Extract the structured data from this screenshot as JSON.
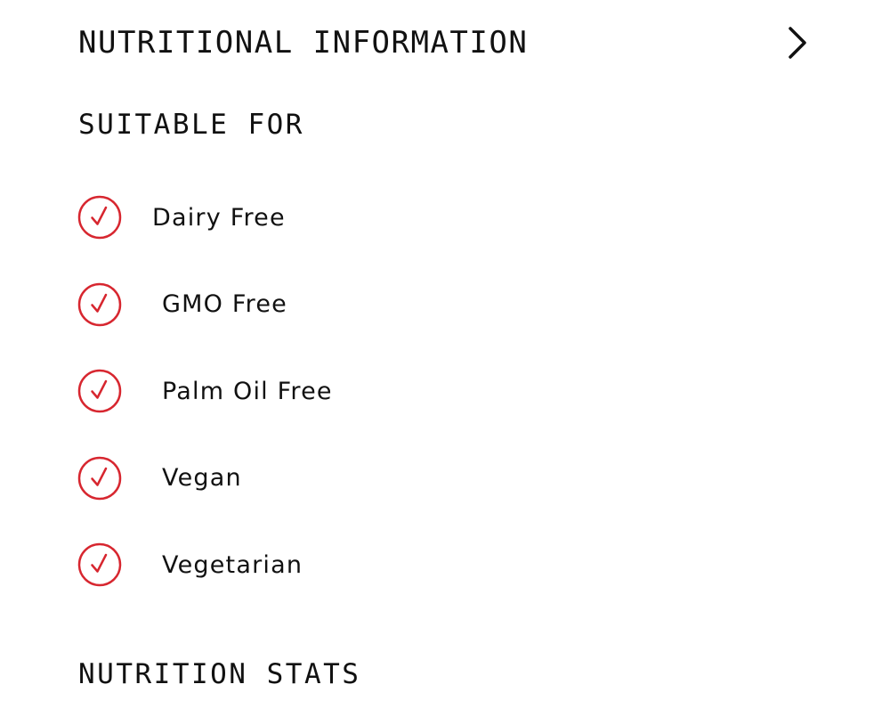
{
  "accordion": {
    "title": "NUTRITIONAL INFORMATION",
    "toggle_icon": "chevron-right-icon"
  },
  "suitable_for": {
    "heading": "SUITABLE FOR",
    "check_icon": "check-circle-icon",
    "accent_color": "#d7262f",
    "items": [
      {
        "label": "Dairy Free"
      },
      {
        "label": "GMO Free"
      },
      {
        "label": "Palm Oil Free"
      },
      {
        "label": "Vegan"
      },
      {
        "label": "Vegetarian"
      }
    ]
  },
  "nutrition_stats": {
    "heading": "NUTRITION STATS"
  }
}
